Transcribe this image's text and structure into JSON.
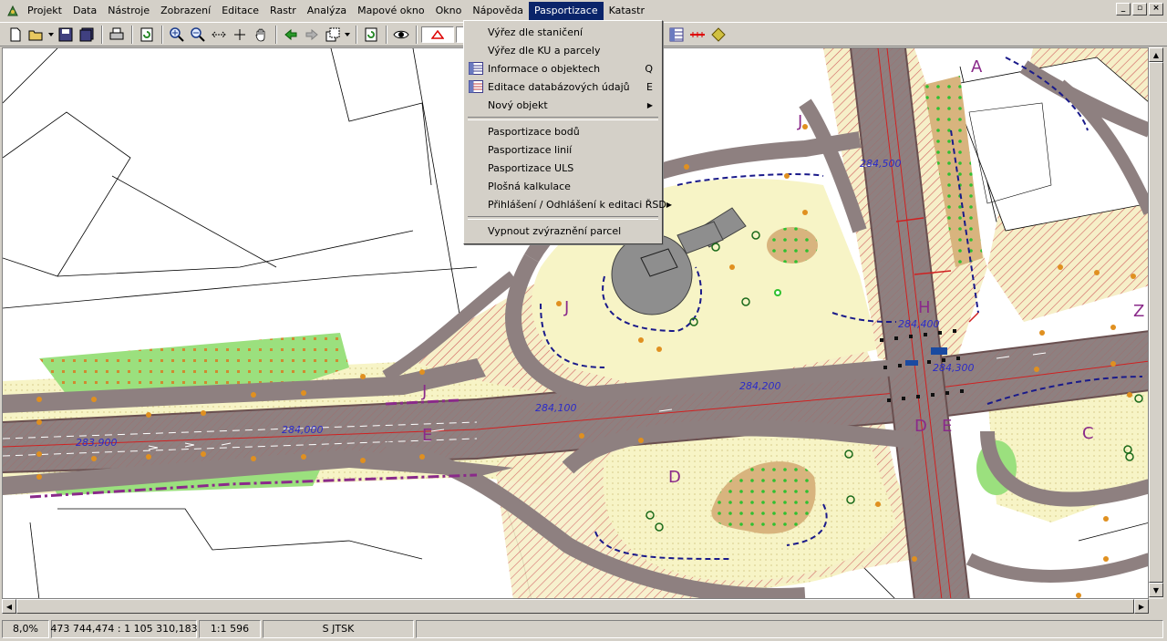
{
  "menubar": {
    "items": [
      "Projekt",
      "Data",
      "Nástroje",
      "Zobrazení",
      "Editace",
      "Rastr",
      "Analýza",
      "Mapové okno",
      "Okno",
      "Nápověda",
      "Pasportizace",
      "Katastr"
    ],
    "active_index": 10
  },
  "window_controls": [
    "_",
    "▫",
    "×"
  ],
  "dropdown": {
    "items": [
      {
        "label": "Výřez dle staničení",
        "shortcut": "",
        "icon": ""
      },
      {
        "label": "Výřez dle KU a parcely",
        "shortcut": "",
        "icon": ""
      },
      {
        "label": "Informace o objektech",
        "shortcut": "Q",
        "icon": "info-table-icon"
      },
      {
        "label": "Editace databázových údajů",
        "shortcut": "E",
        "icon": "edit-table-icon"
      },
      {
        "label": "Nový objekt",
        "shortcut": "",
        "icon": "",
        "submenu": true
      }
    ],
    "group2": [
      {
        "label": "Pasportizace bodů"
      },
      {
        "label": "Pasportizace linií"
      },
      {
        "label": "Pasportizace ULS"
      },
      {
        "label": "Plošná kalkulace"
      },
      {
        "label": "Přihlášení / Odhlášení k editaci ŘSD",
        "submenu": true
      }
    ],
    "group3": [
      {
        "label": "Vypnout zvýraznění parcel"
      }
    ]
  },
  "map": {
    "stationing": [
      "283,900",
      "284,000",
      "284,100",
      "284,200",
      "284,300",
      "284,400",
      "284,500"
    ],
    "zone_labels": [
      "A",
      "J",
      "J",
      "J",
      "H",
      "Z",
      "D",
      "E",
      "D",
      "E",
      "C"
    ],
    "colors": {
      "road": "#8c7f7f",
      "road_edge": "#5a4a4a",
      "grass": "#f6f3c2",
      "green": "#9be07e",
      "sand": "#d8b47e",
      "hatch": "#d04040",
      "station_text": "#2b2bc8",
      "zone_text": "#8a2a8a"
    }
  },
  "statusbar": {
    "zoom": "8,0%",
    "coords": "473 744,474 : 1 105 310,183",
    "scale": "1:1 596",
    "crs": "S JTSK"
  }
}
